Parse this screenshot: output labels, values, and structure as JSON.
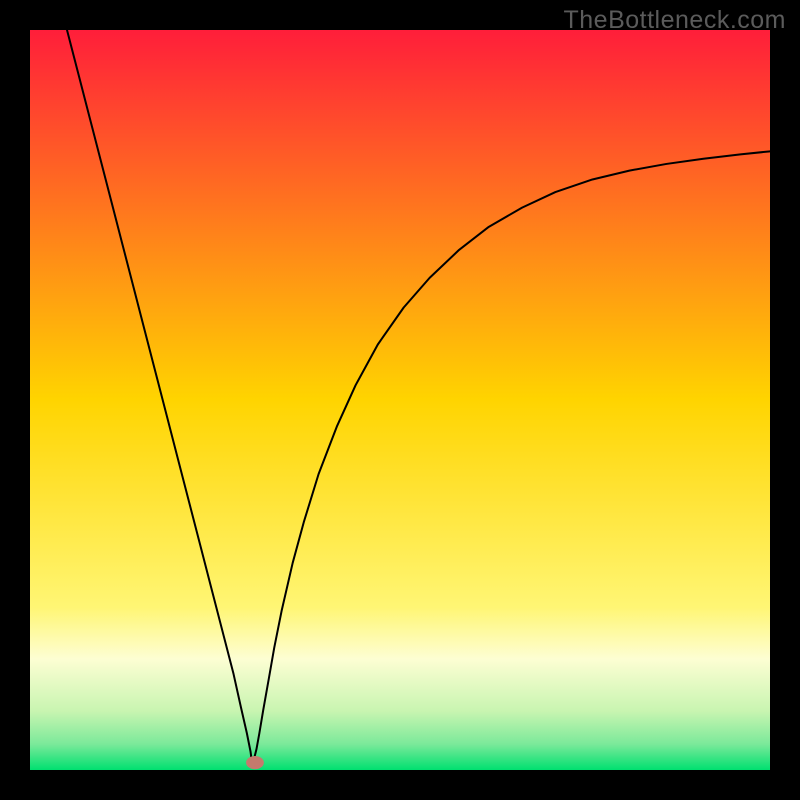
{
  "watermark": "TheBottleneck.com",
  "chart_data": {
    "type": "line",
    "title": "",
    "xlabel": "",
    "ylabel": "",
    "xlim": [
      0,
      100
    ],
    "ylim": [
      0,
      100
    ],
    "grid": false,
    "legend": false,
    "background": {
      "type": "vertical-gradient",
      "stops": [
        {
          "offset": 0.0,
          "color": "#ff1e3a"
        },
        {
          "offset": 0.5,
          "color": "#ffd400"
        },
        {
          "offset": 0.78,
          "color": "#fff674"
        },
        {
          "offset": 0.85,
          "color": "#fdfed3"
        },
        {
          "offset": 0.92,
          "color": "#c9f5b1"
        },
        {
          "offset": 0.965,
          "color": "#7be99a"
        },
        {
          "offset": 1.0,
          "color": "#00e070"
        }
      ]
    },
    "marker": {
      "x": 30.4,
      "y": 1.0,
      "color": "#c47a6d",
      "rx": 1.2,
      "ry": 0.9
    },
    "series": [
      {
        "name": "curve",
        "color": "#000000",
        "stroke_width": 2,
        "x": [
          5.0,
          6.5,
          8.0,
          9.5,
          11.0,
          12.5,
          14.0,
          15.5,
          17.0,
          18.5,
          20.0,
          21.5,
          23.0,
          24.5,
          26.0,
          27.5,
          28.5,
          29.3,
          29.8,
          30.0,
          30.2,
          30.6,
          31.0,
          31.5,
          32.3,
          33.0,
          34.0,
          35.5,
          37.0,
          39.0,
          41.5,
          44.0,
          47.0,
          50.5,
          54.0,
          58.0,
          62.0,
          66.5,
          71.0,
          76.0,
          81.0,
          86.0,
          91.0,
          96.0,
          100.0
        ],
        "y": [
          100.0,
          94.2,
          88.4,
          82.6,
          76.8,
          71.0,
          65.2,
          59.4,
          53.6,
          47.8,
          42.0,
          36.2,
          30.4,
          24.6,
          18.8,
          13.0,
          8.5,
          5.0,
          2.5,
          1.0,
          1.2,
          2.8,
          5.0,
          8.0,
          12.5,
          16.5,
          21.5,
          28.0,
          33.5,
          40.0,
          46.5,
          52.0,
          57.5,
          62.5,
          66.5,
          70.3,
          73.4,
          76.0,
          78.1,
          79.8,
          81.0,
          81.9,
          82.6,
          83.2,
          83.6
        ]
      }
    ]
  }
}
